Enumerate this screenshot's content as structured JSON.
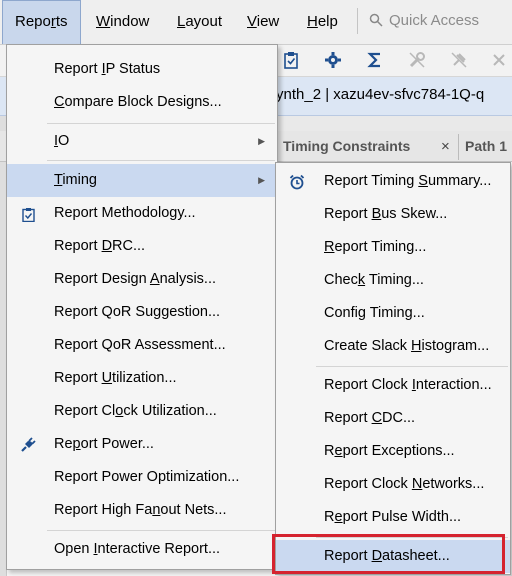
{
  "menubar": {
    "items": [
      "Reports",
      "Window",
      "Layout",
      "View",
      "Help"
    ],
    "quick_access_placeholder": "Quick Access"
  },
  "project_bar": {
    "text": "ynth_2 | xazu4ev-sfvc784-1Q-q"
  },
  "tabs": [
    {
      "label": "Timing Constraints",
      "close": "×"
    },
    {
      "label": "Path 1"
    }
  ],
  "reports_menu": {
    "items": [
      {
        "label": "Report IP Status"
      },
      {
        "label": "Compare Block Designs..."
      },
      {
        "label": "IO"
      },
      {
        "label": "Timing"
      },
      {
        "label": "Report Methodology..."
      },
      {
        "label": "Report DRC..."
      },
      {
        "label": "Report Design Analysis..."
      },
      {
        "label": "Report QoR Suggestion..."
      },
      {
        "label": "Report QoR Assessment..."
      },
      {
        "label": "Report Utilization..."
      },
      {
        "label": "Report Clock Utilization..."
      },
      {
        "label": "Report Power..."
      },
      {
        "label": "Report Power Optimization..."
      },
      {
        "label": "Report High Fanout Nets..."
      },
      {
        "label": "Open Interactive Report..."
      }
    ]
  },
  "timing_submenu": {
    "items": [
      {
        "label": "Report Timing Summary..."
      },
      {
        "label": "Report Bus Skew..."
      },
      {
        "label": "Report Timing..."
      },
      {
        "label": "Check Timing..."
      },
      {
        "label": "Config Timing..."
      },
      {
        "label": "Create Slack Histogram..."
      },
      {
        "label": "Report Clock Interaction..."
      },
      {
        "label": "Report CDC..."
      },
      {
        "label": "Report Exceptions..."
      },
      {
        "label": "Report Clock Networks..."
      },
      {
        "label": "Report Pulse Width..."
      },
      {
        "label": "Report Datasheet..."
      }
    ]
  },
  "icons": {
    "methodology": "clipboard-check-icon",
    "power": "power-plug-icon",
    "timing_summary": "alarm-clock-icon"
  },
  "colors": {
    "menu_highlight": "#cad9f0",
    "callout_red": "#d5232f",
    "icon_blue": "#1f4f8f"
  }
}
